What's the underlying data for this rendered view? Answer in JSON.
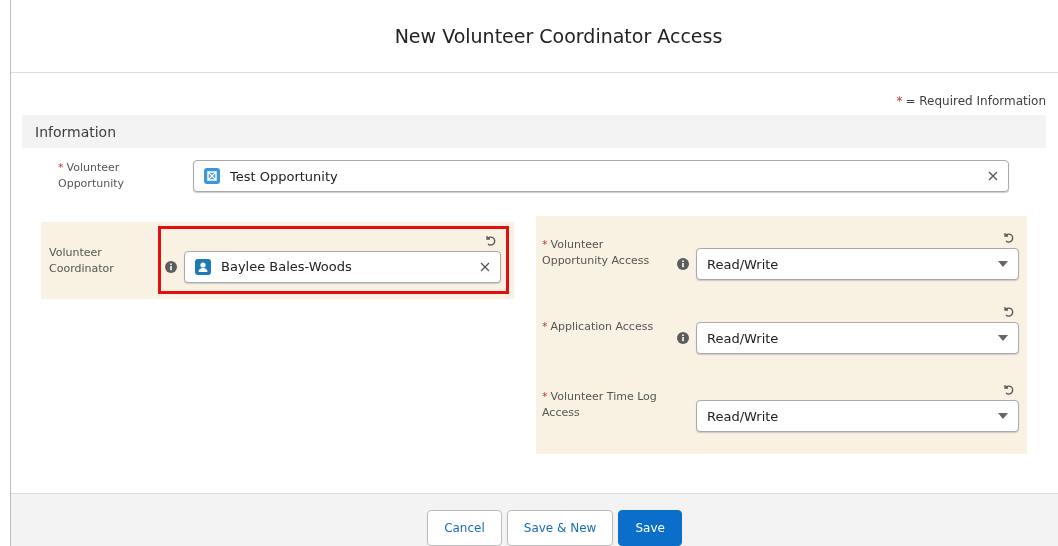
{
  "modal": {
    "title": "New Volunteer Coordinator Access"
  },
  "required_legend": {
    "mark": "*",
    "text": "= Required Information"
  },
  "section": {
    "title": "Information"
  },
  "top_field": {
    "kind": "lookup",
    "label": "Volunteer Opportunity",
    "required": true,
    "value": "Test Opportunity"
  },
  "left_fields": [
    {
      "kind": "lookup",
      "label": "Volunteer Coordinator",
      "required": false,
      "value": "Baylee Bales-Woods",
      "edited": true,
      "info": true,
      "annotated": true
    }
  ],
  "right_fields": [
    {
      "kind": "picklist",
      "label": "Volunteer Opportunity Access",
      "required": true,
      "value": "Read/Write",
      "edited": true,
      "info": true
    },
    {
      "kind": "picklist",
      "label": "Application Access",
      "required": true,
      "value": "Read/Write",
      "edited": true,
      "info": true
    },
    {
      "kind": "picklist",
      "label": "Volunteer Time Log Access",
      "required": true,
      "value": "Read/Write",
      "edited": true,
      "info": false
    }
  ],
  "buttons": [
    {
      "label": "Cancel"
    },
    {
      "label": "Save & New"
    },
    {
      "label": "Save"
    }
  ]
}
